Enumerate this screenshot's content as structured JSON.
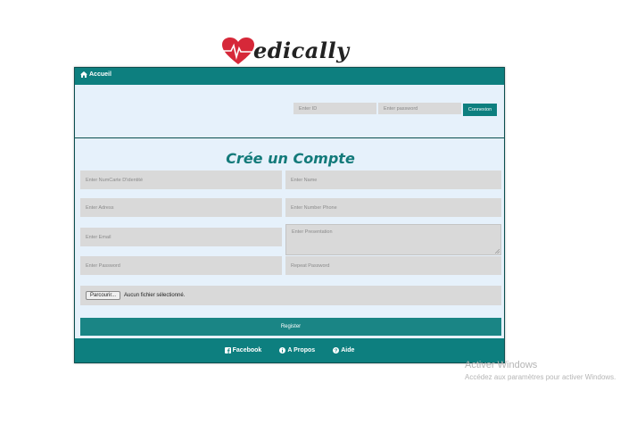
{
  "logo": {
    "text": "edically",
    "icon": "heart-pulse-icon"
  },
  "nav": {
    "home_label": "Accueil",
    "home_icon": "home-icon"
  },
  "login": {
    "id_placeholder": "Enter ID",
    "password_placeholder": "Enter password",
    "connect_label": "Connexion"
  },
  "form": {
    "title": "Crée un Compte",
    "fields": {
      "cin": "Enter NumCarte D'identité",
      "name": "Enter Name",
      "address": "Enter Adress",
      "phone": "Enter Number Phone",
      "email": "Enter Email",
      "presentation": "Enter Presentation",
      "password": "Enter Password",
      "repeat_password": "Repeat Password"
    },
    "file": {
      "button_label": "Parcourir...",
      "status": "Aucun fichier sélectionné."
    },
    "register_label": "Register"
  },
  "footer": {
    "facebook": "Facebook",
    "about": "A Propos",
    "help": "Aide"
  },
  "watermark": {
    "title": "Activer Windows",
    "subtitle": "Accédez aux paramètres pour activer Windows."
  },
  "colors": {
    "accent": "#0d7f7f",
    "panel": "#e6f1fb",
    "input": "#d9d9d9",
    "logo_heart": "#d62839",
    "title": "#137a7a"
  }
}
